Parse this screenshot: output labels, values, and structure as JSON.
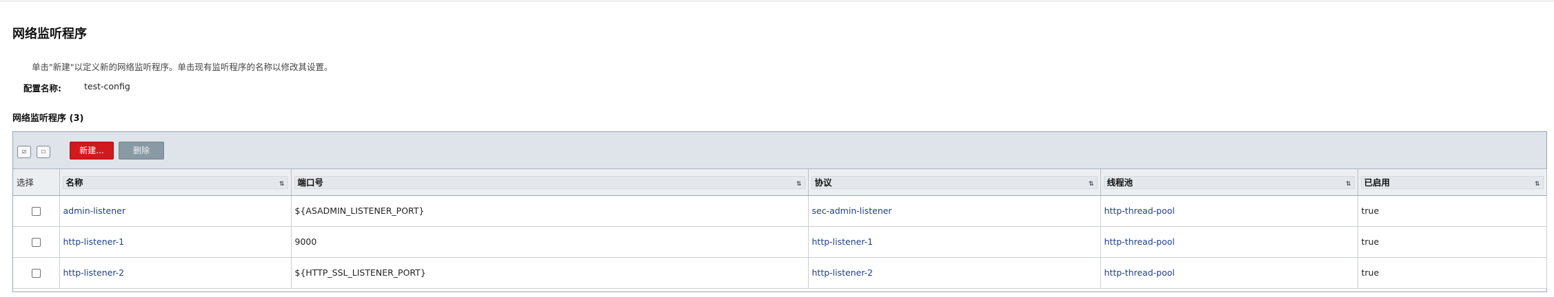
{
  "page": {
    "title": "网络监听程序",
    "help_text": "单击\"新建\"以定义新的网络监听程序。单击现有监听程序的名称以修改其设置。",
    "config_label": "配置名称:",
    "config_value": "test-config"
  },
  "table": {
    "title": "网络监听程序 (3)",
    "toolbar": {
      "select_all_icon": "select-all-icon",
      "deselect_all_icon": "deselect-all-icon",
      "new_label": "新建...",
      "delete_label": "删除"
    },
    "columns": {
      "select": "选择",
      "name": "名称",
      "port": "端口号",
      "protocol": "协议",
      "thread_pool": "线程池",
      "enabled": "已启用"
    },
    "rows": [
      {
        "name": "admin-listener",
        "port": "${ASADMIN_LISTENER_PORT}",
        "protocol": "sec-admin-listener",
        "thread_pool": "http-thread-pool",
        "enabled": "true"
      },
      {
        "name": "http-listener-1",
        "port": "9000",
        "protocol": "http-listener-1",
        "thread_pool": "http-thread-pool",
        "enabled": "true"
      },
      {
        "name": "http-listener-2",
        "port": "${HTTP_SSL_LISTENER_PORT}",
        "protocol": "http-listener-2",
        "thread_pool": "http-thread-pool",
        "enabled": "true"
      }
    ]
  },
  "colors": {
    "primary_button": "#d2191d",
    "disabled_button": "#8a9aa4",
    "link": "#1f3f8c"
  }
}
